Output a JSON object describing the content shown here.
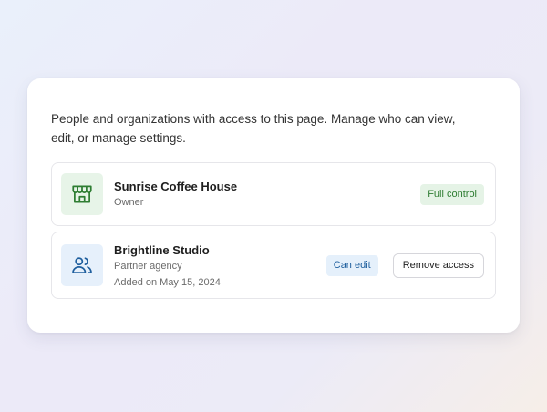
{
  "description": "People and organizations with access to this page. Manage who can view, edit, or manage settings.",
  "members": [
    {
      "name": "Sunrise Coffee House",
      "role": "Owner",
      "permission": "Full control",
      "icon": "storefront-icon",
      "icon_color": "#2e7d32"
    },
    {
      "name": "Brightline Studio",
      "role": "Partner agency",
      "added": "Added on May 15, 2024",
      "permission": "Can edit",
      "icon": "people-icon",
      "icon_color": "#1f5f9e",
      "action_label": "Remove access"
    }
  ],
  "colors": {
    "full_badge_bg": "#e5f3e6",
    "full_badge_text": "#2e7d32",
    "edit_badge_bg": "#e5f0fb",
    "edit_badge_text": "#1f5f9e"
  }
}
